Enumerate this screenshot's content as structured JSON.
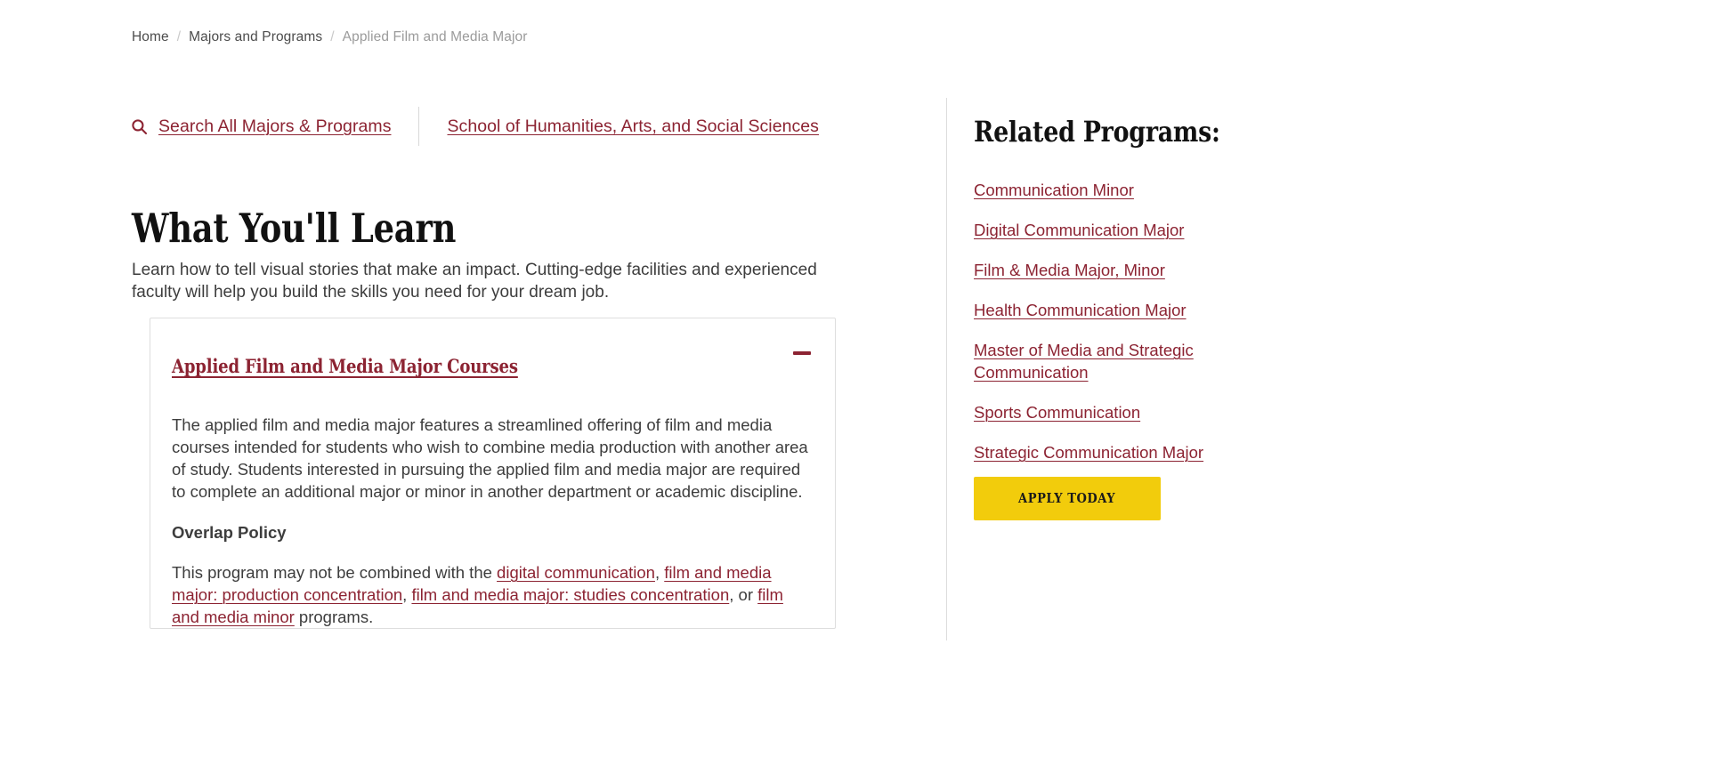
{
  "breadcrumb": {
    "separator": "/",
    "items": [
      {
        "label": "Home",
        "current": false
      },
      {
        "label": "Majors and Programs",
        "current": false
      },
      {
        "label": "Applied Film and Media Major",
        "current": true
      }
    ]
  },
  "utility": {
    "search_icon": "search-icon",
    "search_link": "Search All Majors & Programs",
    "school_link": "School of Humanities, Arts, and Social Sciences"
  },
  "main": {
    "heading": "What You'll Learn",
    "intro": "Learn how to tell visual stories that make an impact. Cutting-edge facilities and experienced faculty will help you build the skills you need for your dream job.",
    "accordion": {
      "title": "Applied Film and Media Major Courses",
      "toggle_icon": "minus-icon",
      "expanded": true,
      "paragraph": "The applied film and media major features a streamlined offering of film and media courses intended for students who wish to combine media production with another area of study. Students interested in pursuing the applied film and media major are required to complete an additional major or minor in another department or academic discipline.",
      "policy_label": "Overlap Policy",
      "policy_prefix": "This program may not be combined with the ",
      "policy_links": [
        {
          "label": "digital communication",
          "after": ","
        },
        {
          "label": "film and media major: production concentration",
          "after": ","
        },
        {
          "label": "film and media major: studies concentration",
          "after": ", or "
        },
        {
          "label": "film and media minor",
          "after": " programs."
        }
      ]
    }
  },
  "sidebar": {
    "heading": "Related Programs:",
    "links": [
      "Communication Minor",
      "Digital Communication Major",
      "Film & Media Major, Minor",
      "Health Communication Major",
      "Master of Media and Strategic Communication",
      "Sports Communication",
      "Strategic Communication Major"
    ],
    "apply_button": "Apply Today"
  },
  "colors": {
    "accent_maroon": "#8c2332",
    "accent_gold": "#f2cc0c",
    "text_dark": "#3d3d3d"
  }
}
